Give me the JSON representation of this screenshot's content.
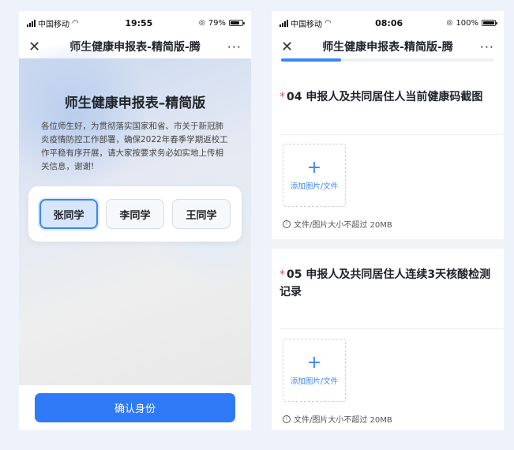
{
  "phone1": {
    "status": {
      "carrier": "中国移动",
      "time": "19:55",
      "battery": "79%",
      "battery_level": 0.79
    },
    "nav": {
      "close_glyph": "✕",
      "title": "师生健康申报表-精简版-腾",
      "more_glyph": "···"
    },
    "form_title": "师生健康申报表–精简版",
    "description": "各位师生好，为贯彻落实国家和省、市关于新冠肺炎疫情防控工作部署，确保2022年春季学期返校工作平稳有序开展，请大家按要求务必如实地上传相关信息，谢谢!",
    "people": [
      {
        "name": "张同学",
        "selected": true
      },
      {
        "name": "李同学",
        "selected": false
      },
      {
        "name": "王同学",
        "selected": false
      }
    ],
    "confirm_label": "确认身份"
  },
  "phone2": {
    "status": {
      "carrier": "中国移动",
      "time": "08:06",
      "battery": "100%",
      "battery_level": 1.0
    },
    "nav": {
      "close_glyph": "✕",
      "title": "师生健康申报表-精简版-腾",
      "more_glyph": "···"
    },
    "progress": 0.28,
    "questions": [
      {
        "star": "*",
        "title": "04  申报人及共同居住人当前健康码截图",
        "upload_plus": "+",
        "upload_label": "添加图片/文件",
        "hint": "文件/图片大小不超过 20MB"
      },
      {
        "star": "*",
        "title": "05  申报人及共同居住人连续3天核酸检测记录",
        "upload_plus": "+",
        "upload_label": "添加图片/文件",
        "hint": "文件/图片大小不超过 20MB"
      }
    ]
  },
  "colors": {
    "accent": "#2f7af6",
    "required_star": "#e34d59",
    "background": "#eef2fb"
  },
  "icons": {
    "close": "close-icon",
    "more": "more-icon",
    "wifi": "wifi-icon",
    "signal": "signal-icon",
    "battery": "battery-icon",
    "info": "info-icon",
    "plus": "plus-icon"
  }
}
